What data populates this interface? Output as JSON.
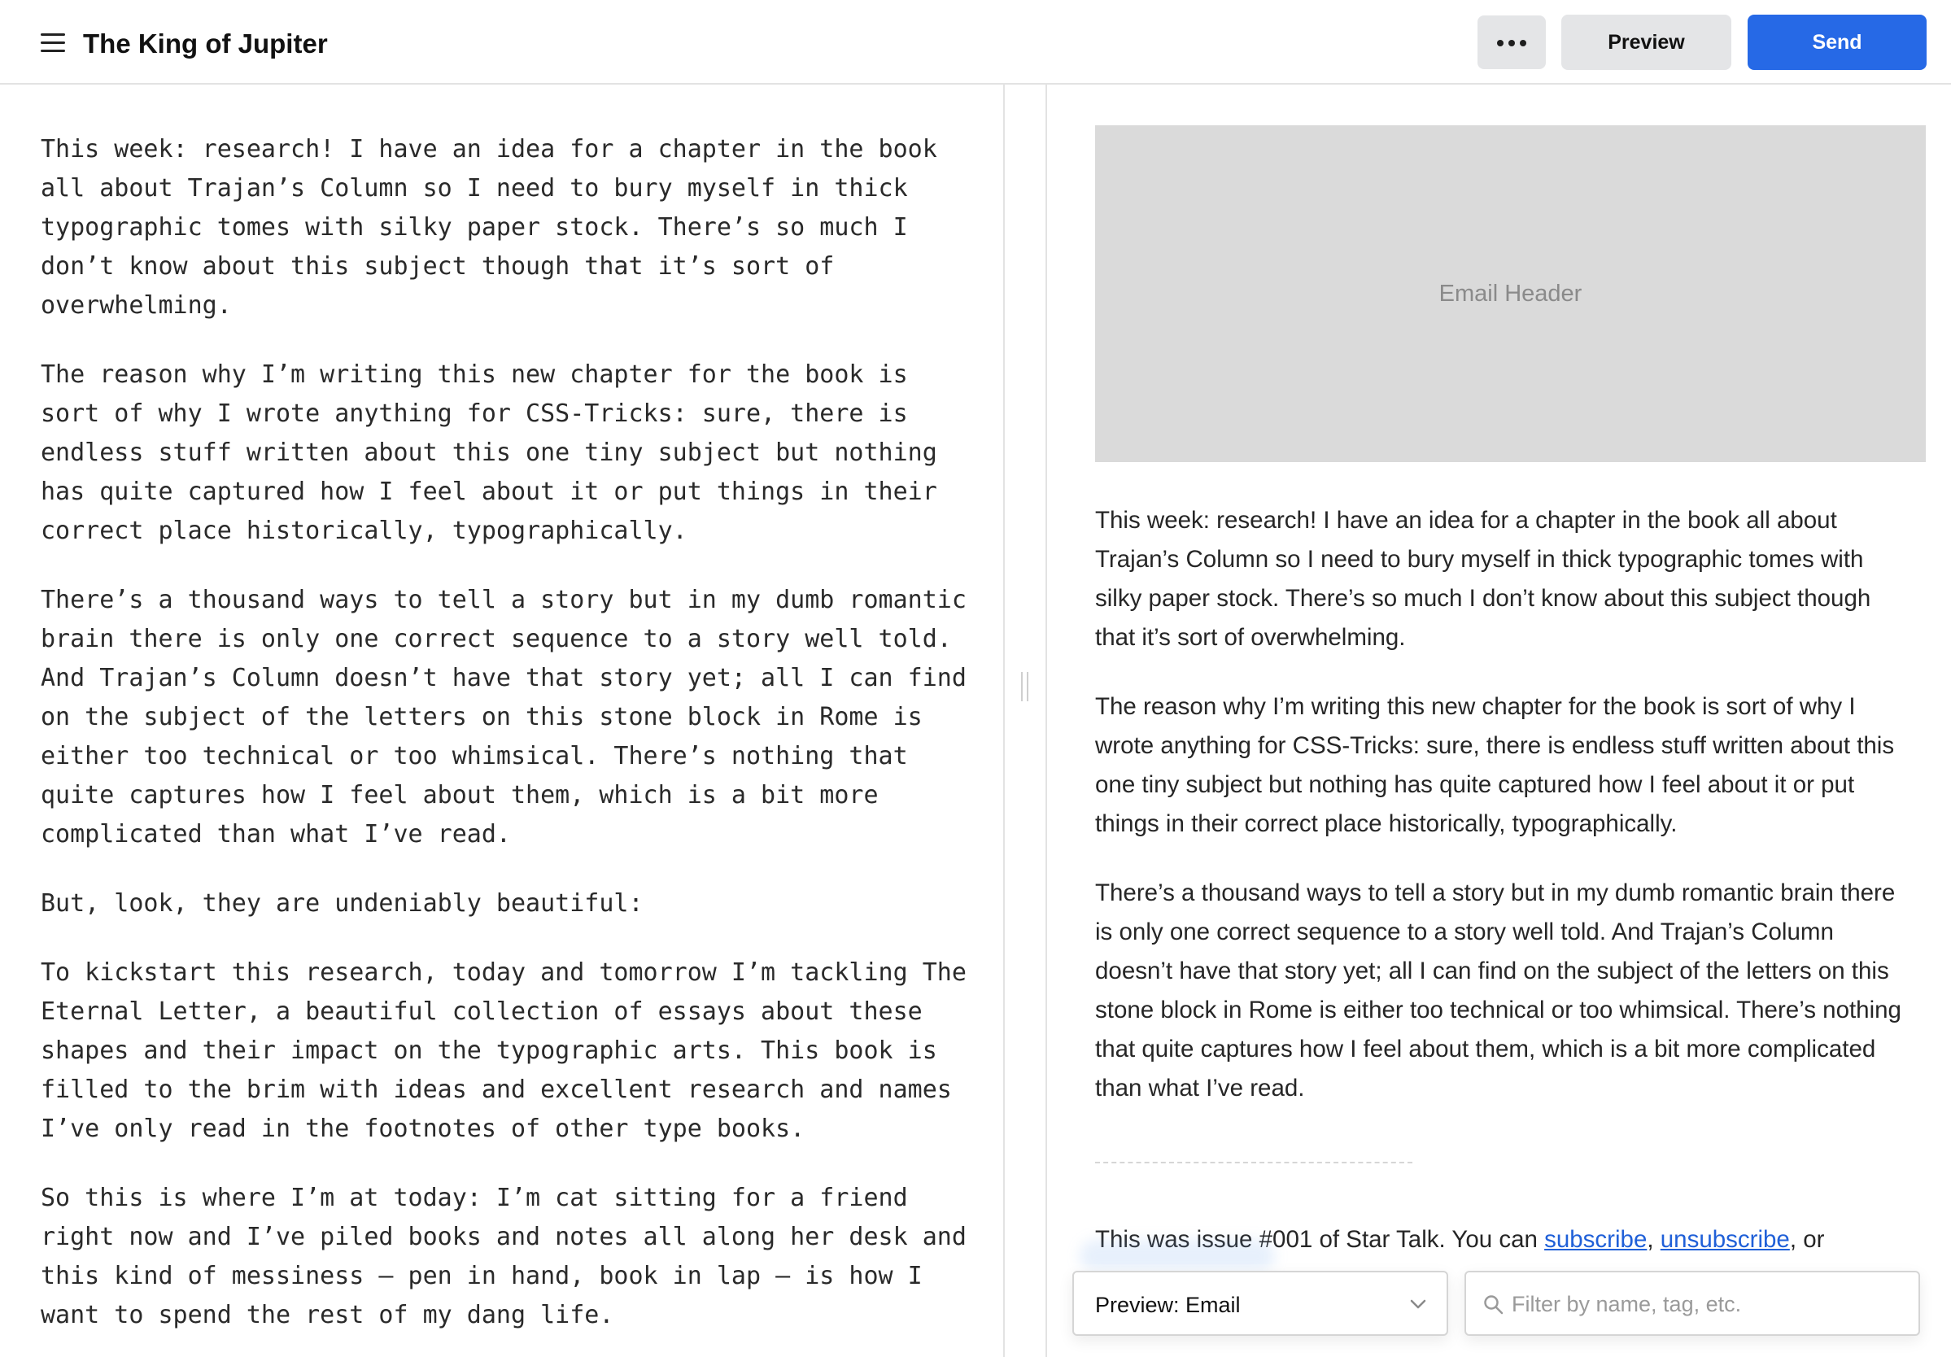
{
  "header": {
    "title": "The King of Jupiter",
    "more_icon": "more-horizontal-icon",
    "menu_icon": "hamburger-menu-icon",
    "preview_label": "Preview",
    "send_label": "Send",
    "send_color": "#2669e6"
  },
  "editor": {
    "paragraphs": [
      "This week: research! I have an idea for a chapter in the book all about Trajan’s Column so I need to bury myself in thick typographic tomes with silky paper stock. There’s so much I don’t know about this subject though that it’s sort of overwhelming.",
      "The reason why I’m writing this new chapter for the book is sort of why I wrote anything for CSS-Tricks: sure, there is endless stuff written about this one tiny subject but nothing has quite captured how I feel about it or put things in their correct place historically, typographically.",
      "There’s a thousand ways to tell a story but in my dumb romantic brain there is only one correct sequence to a story well told. And Trajan’s Column doesn’t have that story yet; all I can find on the subject of the letters on this stone block in Rome is either too technical or too whimsical. There’s nothing that quite captures how I feel about them, which is a bit more complicated than what I’ve read.",
      "But, look, they are undeniably beautiful:",
      "To kickstart this research, today and tomorrow I’m tackling The Eternal Letter, a beautiful collection of essays about these shapes and their impact on the typographic arts. This book is filled to the brim with ideas and excellent research and names I’ve only read in the footnotes of other type books.",
      "So this is where I’m at today: I’m cat sitting for a friend right now and I’ve piled books and notes all along her desk and this kind of messiness — pen in hand, book in lap — is how I want to spend the rest of my dang life."
    ]
  },
  "preview": {
    "email_header_label": "Email Header",
    "paragraphs": [
      "This week: research! I have an idea for a chapter in the book all about Trajan’s Column so I need to bury myself in thick typographic tomes with silky paper stock. There’s so much I don’t know about this subject though that it’s sort of overwhelming.",
      "The reason why I’m writing this new chapter for the book is sort of why I wrote anything for CSS-Tricks: sure, there is endless stuff written about this one tiny subject but nothing has quite captured how I feel about it or put things in their correct place historically, typographically.",
      "There’s a thousand ways to tell a story but in my dumb romantic brain there is only one correct sequence to a story well told. And Trajan’s Column doesn’t have that story yet; all I can find on the subject of the letters on this stone block in Rome is either too technical or too whimsical. There’s nothing that quite captures how I feel about them, which is a bit more complicated than what I’ve read."
    ],
    "footer": {
      "text_before": "This was issue #001 of Star Talk. You can ",
      "subscribe_link": "subscribe",
      "separator": ", ",
      "unsubscribe_link": "unsubscribe",
      "text_after": ", or",
      "link_color": "#2060d8"
    }
  },
  "controls": {
    "preview_mode_value": "Preview: Email",
    "filter_placeholder": "Filter by name, tag, etc.",
    "filter_value": ""
  }
}
